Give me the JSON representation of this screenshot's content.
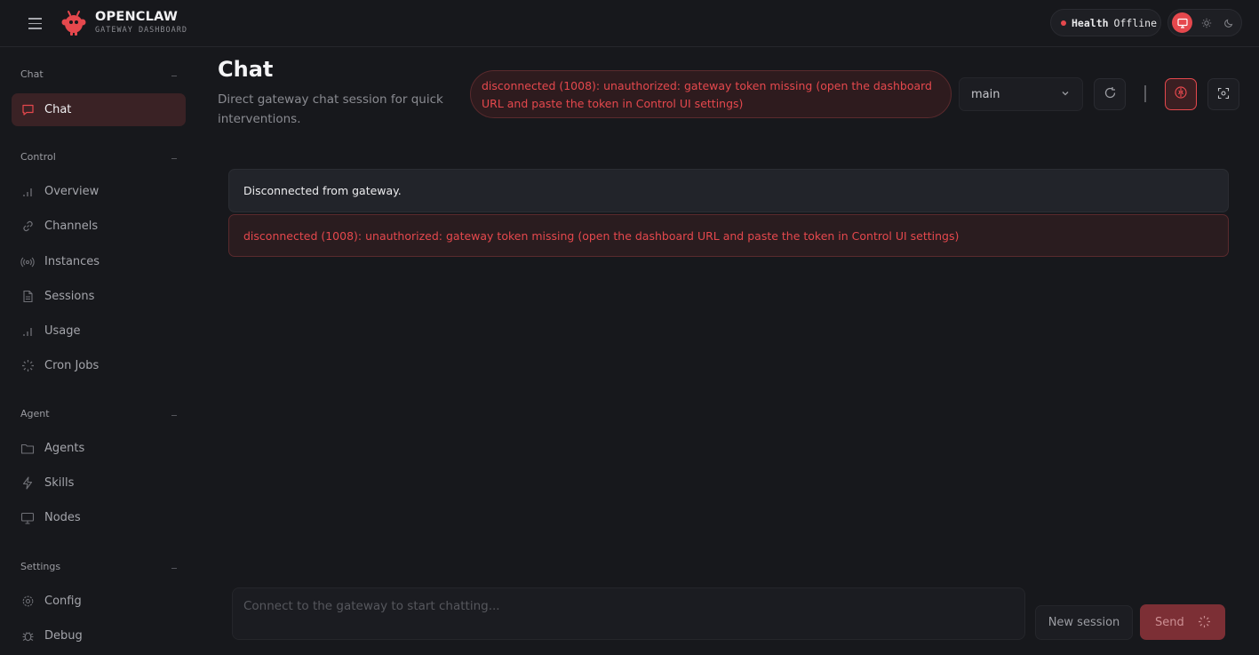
{
  "header": {
    "brand_name": "OPENCLAW",
    "brand_sub": "GATEWAY DASHBOARD",
    "health_label": "Health",
    "health_value": "Offline"
  },
  "sidebar": {
    "sections": [
      {
        "title": "Chat",
        "items": [
          {
            "label": "Chat",
            "icon": "message-icon",
            "active": true
          }
        ]
      },
      {
        "title": "Control",
        "items": [
          {
            "label": "Overview",
            "icon": "bar-chart-icon"
          },
          {
            "label": "Channels",
            "icon": "link-icon"
          },
          {
            "label": "Instances",
            "icon": "broadcast-icon"
          },
          {
            "label": "Sessions",
            "icon": "document-icon"
          },
          {
            "label": "Usage",
            "icon": "bar-chart-icon"
          },
          {
            "label": "Cron Jobs",
            "icon": "loader-icon"
          }
        ]
      },
      {
        "title": "Agent",
        "items": [
          {
            "label": "Agents",
            "icon": "folder-icon"
          },
          {
            "label": "Skills",
            "icon": "bolt-icon"
          },
          {
            "label": "Nodes",
            "icon": "monitor-icon"
          }
        ]
      },
      {
        "title": "Settings",
        "items": [
          {
            "label": "Config",
            "icon": "gear-icon"
          },
          {
            "label": "Debug",
            "icon": "bug-icon"
          }
        ]
      }
    ]
  },
  "main": {
    "title": "Chat",
    "subtitle": "Direct gateway chat session for quick interventions.",
    "error_banner": "disconnected (1008): unauthorized: gateway token missing (open the dashboard URL and paste the token in Control UI settings)",
    "session_select": "main",
    "messages": [
      {
        "type": "info",
        "text": "Disconnected from gateway."
      },
      {
        "type": "error",
        "text": "disconnected (1008): unauthorized: gateway token missing (open the dashboard URL and paste the token in Control UI settings)"
      }
    ]
  },
  "composer": {
    "placeholder": "Connect to the gateway to start chatting...",
    "new_session_label": "New session",
    "send_label": "Send"
  },
  "colors": {
    "accent": "#e5484d",
    "background": "#17181c",
    "active_nav_bg": "#3a2225"
  }
}
